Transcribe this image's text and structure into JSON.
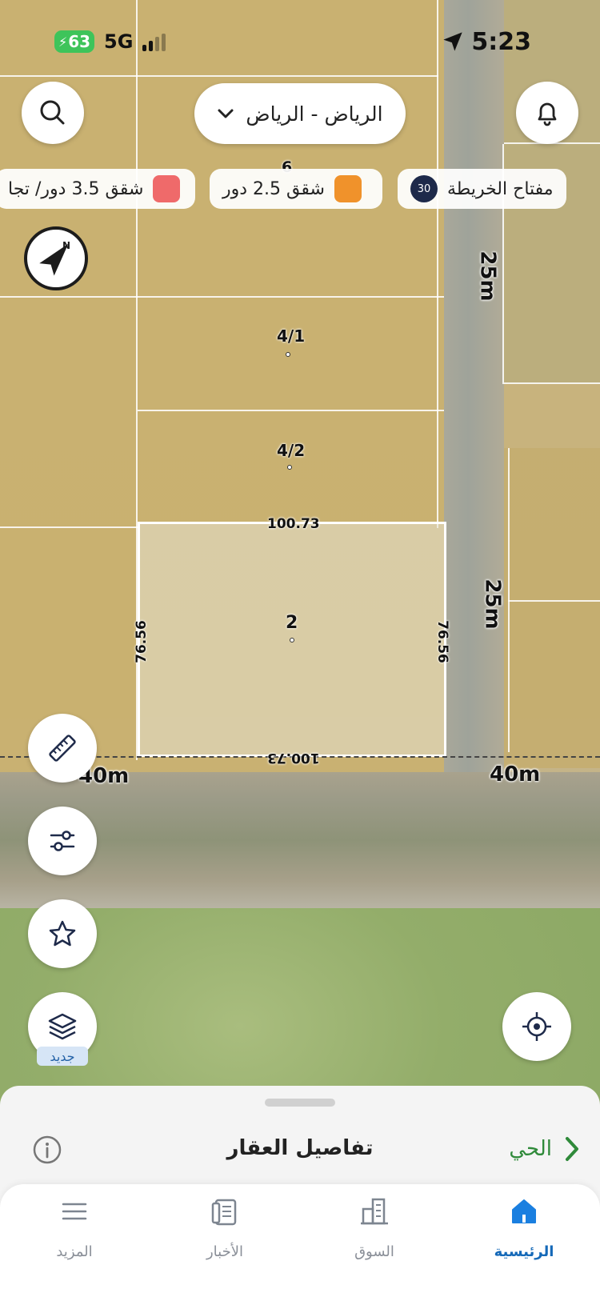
{
  "status_bar": {
    "battery": "63",
    "network": "5G",
    "time": "5:23"
  },
  "header": {
    "city_selector": "الرياض - الرياض"
  },
  "legend": {
    "map_key_label": "مفتاح الخريطة",
    "map_key_badge": "30",
    "chips": [
      {
        "label": "شقق 2.5 دور",
        "color": "#f0922b"
      },
      {
        "label": "شقق 3.5 دور/ تجا",
        "color": "#ef6a6a"
      }
    ]
  },
  "map": {
    "plots": [
      {
        "id": "6"
      },
      {
        "id": "4/1"
      },
      {
        "id": "4/2"
      },
      {
        "id": "2"
      }
    ],
    "dimensions": {
      "top": "100.73",
      "bottom": "100.73",
      "left": "76.56",
      "right": "76.56"
    },
    "roads": {
      "vertical_upper": "25m",
      "vertical_lower": "25m",
      "horizontal_left": "40m",
      "horizontal_right": "40m"
    }
  },
  "tools": {
    "new_badge": "جديد"
  },
  "sheet": {
    "title": "تفاصيل العقار",
    "neighborhood_link": "الحي"
  },
  "tabs": [
    {
      "label": "الرئيسية",
      "active": true
    },
    {
      "label": "السوق",
      "active": false
    },
    {
      "label": "الأخبار",
      "active": false
    },
    {
      "label": "المزيد",
      "active": false
    }
  ]
}
